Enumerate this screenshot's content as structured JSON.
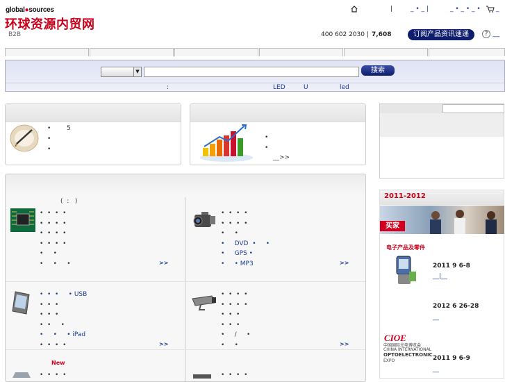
{
  "header": {
    "logo_en": "global",
    "logo_en2": "sources",
    "logo_cn": "环球资源内贸网",
    "b2b": "B2B",
    "phone": "400 602 2030 |",
    "count": "7,608",
    "subscribe_label": "订阅产品资讯速递",
    "help_q": "?",
    "topnav": [
      "|",
      "_ • _ |",
      "_ • _ • _ •"
    ]
  },
  "search": {
    "button_label": "搜索",
    "hot_label": ":",
    "hot_keywords": [
      "LED",
      "U",
      "led"
    ]
  },
  "panel1": {
    "items": [
      "5",
      "",
      ""
    ]
  },
  "panel2": {
    "more": "__>>"
  },
  "bigpanel": {
    "subtitle": "(  :   )",
    "new_badge": "New",
    "more": ">>",
    "cells": [
      {
        "lines": [
          "•  •  •  •",
          "•  •  •  •",
          "•  •  •  •",
          "•  •  •  •",
          "•     •",
          "•     •     •"
        ]
      },
      {
        "lines": [
          "•  •  •  •",
          "•  •  •  •",
          "•     •",
          "•     DVD  •     •",
          "•     GPS •",
          "•     • MP3"
        ]
      },
      {
        "lines": [
          "•  •  •     • USB",
          "•  •  •",
          "•  •  •",
          "•  •     •",
          "•     •     • iPad",
          "•  •  •  •"
        ]
      },
      {
        "lines": [
          "•  •  •  •",
          "•  •  •  •",
          "•  •  •",
          "•  •  •",
          "•     /     •",
          "•     •"
        ]
      }
    ]
  },
  "sidebar": {
    "title": "2011-2012",
    "banner_label": "买家",
    "events": [
      {
        "date": "2011  9  6-8",
        "link": "__|__"
      },
      {
        "date": "2012  6  26-28",
        "link": "__"
      },
      {
        "date": "2011  9  6-9",
        "link": "__"
      }
    ],
    "expo1_title": "电子产品及零件",
    "expo2_logo": "CIOE",
    "expo2_cn": "中国国际光电博览会",
    "expo2_en1": "CHINA INTERNATIONAL",
    "expo2_en2": "OPTOELECTRONIC",
    "expo2_en3": "EXPO"
  },
  "colors": {
    "brand_red": "#c8001a",
    "navy": "#0e1d6e",
    "link": "#1a3c96"
  }
}
